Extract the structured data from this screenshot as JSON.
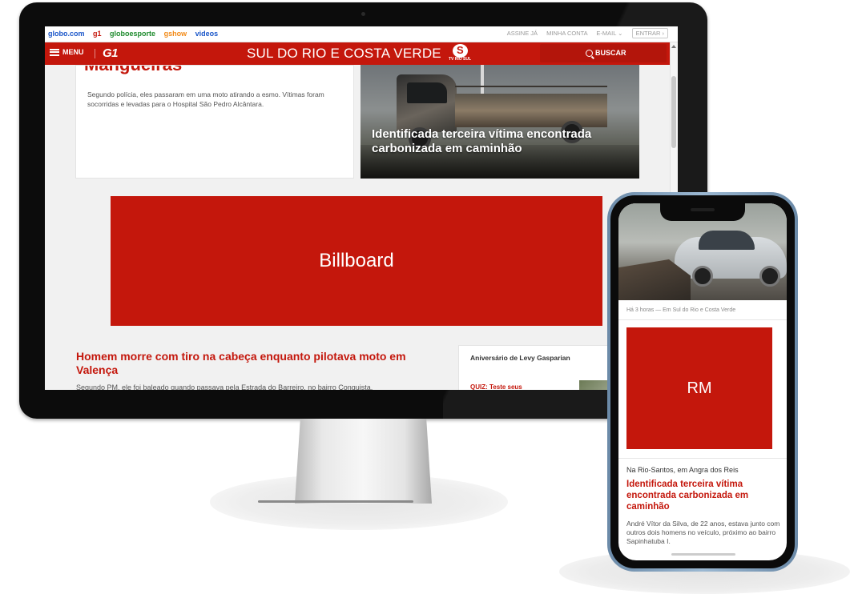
{
  "desktop": {
    "topbar": {
      "links": [
        "globo.com",
        "g1",
        "globoesporte",
        "gshow",
        "videos"
      ],
      "account": [
        "ASSINE JÁ",
        "MINHA CONTA",
        "E-MAIL ⌄",
        "ENTRAR ›"
      ]
    },
    "header": {
      "menu_label": "MENU",
      "logo": "G1",
      "region": "SUL DO RIO E COSTA VERDE",
      "tv_brand": "TV RIO SUL",
      "search_label": "BUSCAR"
    },
    "top_left_story": {
      "title_fragment": "Mangueiras",
      "summary": "Segundo polícia, eles passaram em uma moto atirando a esmo. Vítimas foram socorridas e levadas para o Hospital São Pedro Alcântara."
    },
    "top_right_story": {
      "headline": "Identificada terceira vítima encontrada carbonizada em caminhão"
    },
    "billboard_label": "Billboard",
    "story2": {
      "title": "Homem morre com tiro na cabeça enquanto pilotava moto em Valença",
      "summary": "Segundo PM, ele foi baleado quando passava pela Estrada do Barreiro, no bairro Conquista."
    },
    "aside": {
      "title": "Aniversário de Levy Gasparian",
      "quiz": "QUIZ: Teste seus"
    }
  },
  "mobile": {
    "meta": "Há 3 horas — Em Sul do Rio e Costa Verde",
    "ad_label": "RM",
    "kicker": "Na Rio-Santos, em Angra dos Reis",
    "title": "Identificada terceira vítima encontrada carbonizada em caminhão",
    "summary": "André Vítor da Silva, de 22 anos, estava junto com outros dois homens no veículo, próximo ao bairro Sapinhatuba I."
  },
  "colors": {
    "brand_red": "#c4170c",
    "link_blue": "#1a56c9",
    "ge_green": "#1d8a2c",
    "gshow_orange": "#f28a17"
  }
}
